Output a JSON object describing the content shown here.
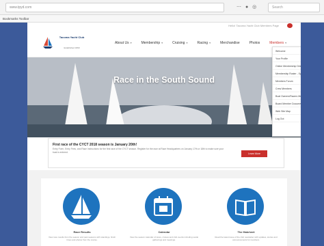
{
  "browser": {
    "url": "www.tpyd.com",
    "search_placeholder": "Search",
    "bookmark": "Bookmarks Toolbar"
  },
  "site": {
    "top_message": "Hello! Tacoma Yacht Club Members Page",
    "logo": {
      "name": "Tacoma Yacht Club",
      "sub": "Established 1890"
    },
    "nav": [
      "About Us",
      "Membership",
      "Cruising",
      "Racing",
      "Merchandise",
      "Photos",
      "Members"
    ],
    "hero_title": "Race in the South Sound",
    "dropdown_items": [
      "Welcome",
      "Your Profile",
      "Online Membership Directory",
      "Membership Roster - Spreadsheet",
      "Members Forum",
      "Crew Members",
      "Boat Owners/Racers Members",
      "Board Member Documents",
      "Web Site Map",
      "Log Out"
    ]
  },
  "news": {
    "title": "First race of the CYCT 2018 season is January 20th!",
    "body": "Entry Form, Entry Fees, and Race Instructions for the first race of the CYCT season. Register for the race at Race Headquarters on January 17th or 18th to make sure your boat is entered.",
    "button": "Learn More"
  },
  "features": [
    {
      "title": "Race Results",
      "text": "View race results from the season and past seasons with standings, finish times and photos from the course."
    },
    {
      "title": "Calendar",
      "text": "View the season calendar of races, cruises and club events including social gatherings and meetings."
    },
    {
      "title": "The Hatcheet",
      "text": "Read the latest issue of the club newsletter with updates, stories and announcements for members."
    }
  ]
}
